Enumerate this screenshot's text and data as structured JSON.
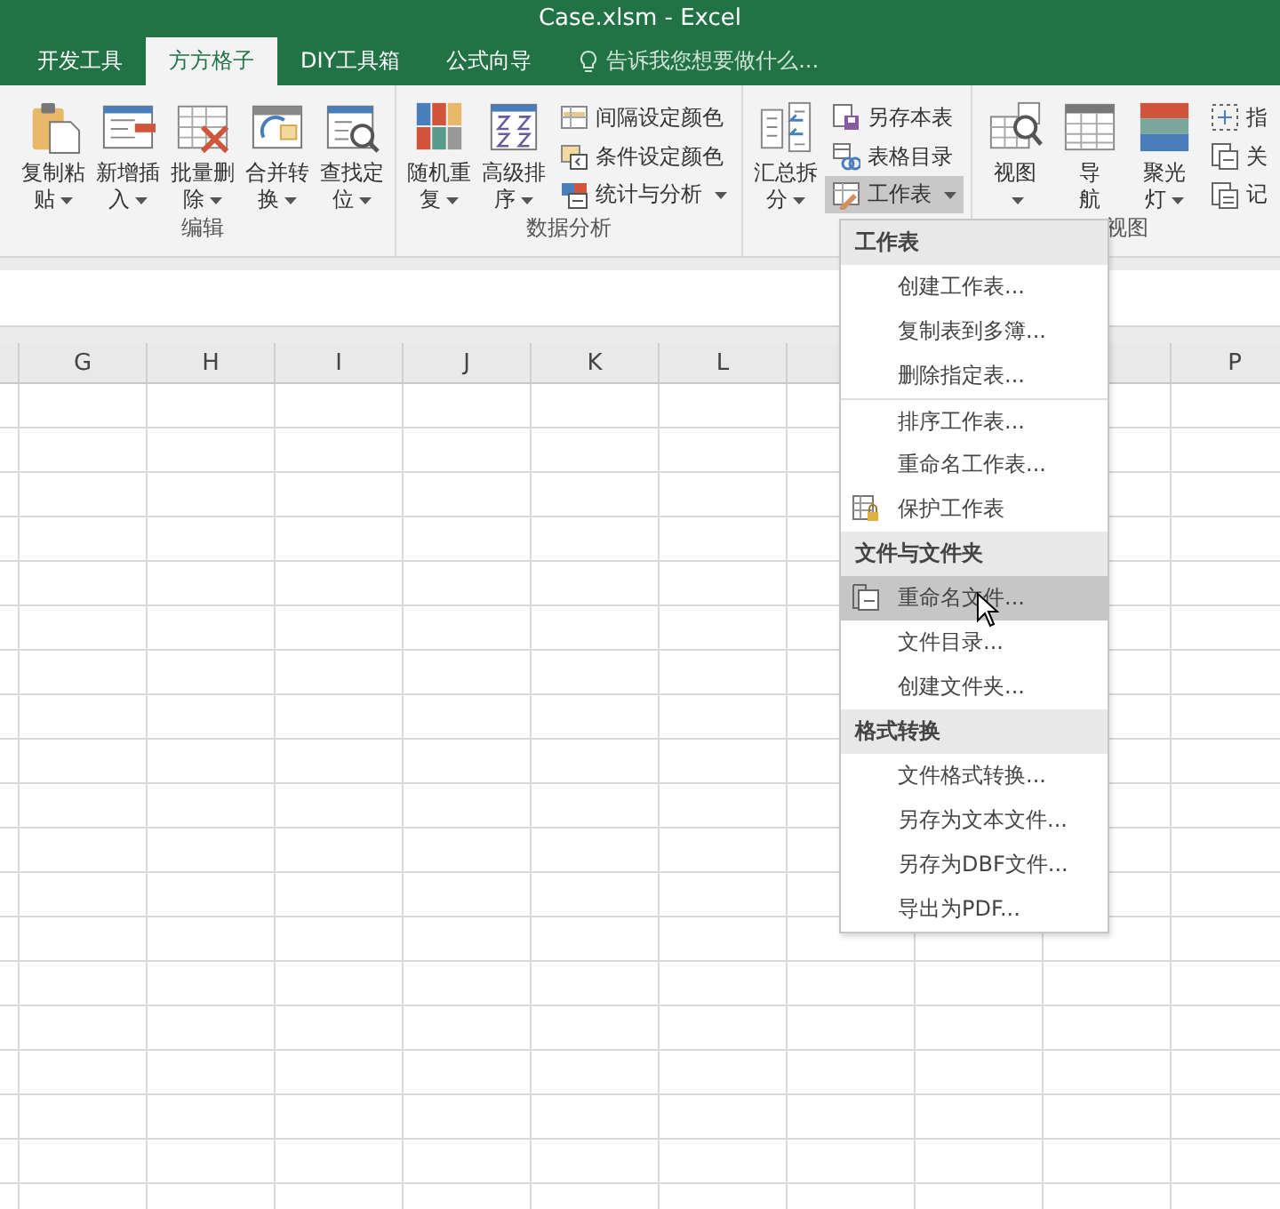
{
  "window": {
    "title": "Case.xlsm - Excel"
  },
  "tabs": [
    {
      "label": "开发工具",
      "selected": false
    },
    {
      "label": "方方格子",
      "selected": true
    },
    {
      "label": "DIY工具箱",
      "selected": false
    },
    {
      "label": "公式向导",
      "selected": false
    }
  ],
  "tell_me": {
    "placeholder": "告诉我您想要做什么..."
  },
  "ribbon_groups": [
    {
      "label": "编辑",
      "items": [
        {
          "kind": "large",
          "lines": [
            "复制粘",
            "贴"
          ],
          "dropdown": true
        },
        {
          "kind": "large",
          "lines": [
            "新增插",
            "入"
          ],
          "dropdown": true
        },
        {
          "kind": "large",
          "lines": [
            "批量删",
            "除"
          ],
          "dropdown": true
        },
        {
          "kind": "large",
          "lines": [
            "合并转",
            "换"
          ],
          "dropdown": true
        },
        {
          "kind": "large",
          "lines": [
            "查找定",
            "位"
          ],
          "dropdown": true
        }
      ]
    },
    {
      "label": "数据分析",
      "items": [
        {
          "kind": "large",
          "lines": [
            "随机重",
            "复"
          ],
          "dropdown": true
        },
        {
          "kind": "large",
          "lines": [
            "高级排",
            "序"
          ],
          "dropdown": true
        },
        {
          "kind": "stack",
          "buttons": [
            {
              "label": "间隔设定颜色",
              "dropdown": false,
              "pressed": false
            },
            {
              "label": "条件设定颜色",
              "dropdown": false,
              "pressed": false
            },
            {
              "label": "统计与分析",
              "dropdown": true,
              "pressed": false
            }
          ]
        }
      ]
    },
    {
      "items": [
        {
          "kind": "large",
          "lines": [
            "汇总拆",
            "分"
          ],
          "dropdown": true
        },
        {
          "kind": "stack",
          "buttons": [
            {
              "label": "另存本表",
              "dropdown": false,
              "pressed": false
            },
            {
              "label": "表格目录",
              "dropdown": false,
              "pressed": false
            },
            {
              "label": "工作表",
              "dropdown": true,
              "pressed": true
            }
          ]
        }
      ]
    },
    {
      "label": "视图",
      "items": [
        {
          "kind": "large",
          "lines": [
            "视图"
          ],
          "dropdown": true
        },
        {
          "kind": "large",
          "lines": [
            "导",
            "航"
          ],
          "dropdown": false
        },
        {
          "kind": "large",
          "lines": [
            "聚光",
            "灯"
          ],
          "dropdown": true
        },
        {
          "kind": "stack",
          "buttons": [
            {
              "label": "指",
              "dropdown": false,
              "pressed": false
            },
            {
              "label": "关",
              "dropdown": false,
              "pressed": false
            },
            {
              "label": "记",
              "dropdown": false,
              "pressed": false
            }
          ]
        }
      ]
    }
  ],
  "sheet": {
    "columns_left": [
      "G",
      "H",
      "I",
      "J",
      "K",
      "L"
    ],
    "columns_right": [
      "P"
    ]
  },
  "menu": {
    "sections": [
      {
        "header": "工作表",
        "items": [
          {
            "label": "创建工作表...",
            "has_icon": false,
            "selected": false,
            "divider_before": false
          },
          {
            "label": "复制表到多簿...",
            "has_icon": false,
            "selected": false,
            "divider_before": false
          },
          {
            "label": "删除指定表...",
            "has_icon": false,
            "selected": false,
            "divider_before": false
          },
          {
            "label": "排序工作表...",
            "has_icon": false,
            "selected": false,
            "divider_before": true
          },
          {
            "label": "重命名工作表...",
            "has_icon": false,
            "selected": false,
            "divider_before": false
          },
          {
            "label": "保护工作表",
            "has_icon": true,
            "selected": false,
            "divider_before": false
          }
        ]
      },
      {
        "header": "文件与文件夹",
        "items": [
          {
            "label": "重命名文件...",
            "has_icon": true,
            "selected": true,
            "divider_before": false
          },
          {
            "label": "文件目录...",
            "has_icon": false,
            "selected": false,
            "divider_before": false
          },
          {
            "label": "创建文件夹...",
            "has_icon": false,
            "selected": false,
            "divider_before": false
          }
        ]
      },
      {
        "header": "格式转换",
        "items": [
          {
            "label": "文件格式转换...",
            "has_icon": false,
            "selected": false,
            "divider_before": false
          },
          {
            "label": "另存为文本文件...",
            "has_icon": false,
            "selected": false,
            "divider_before": false
          },
          {
            "label": "另存为DBF文件...",
            "has_icon": false,
            "selected": false,
            "divider_before": false
          },
          {
            "label": "导出为PDF...",
            "has_icon": false,
            "selected": false,
            "divider_before": false
          }
        ]
      }
    ]
  }
}
